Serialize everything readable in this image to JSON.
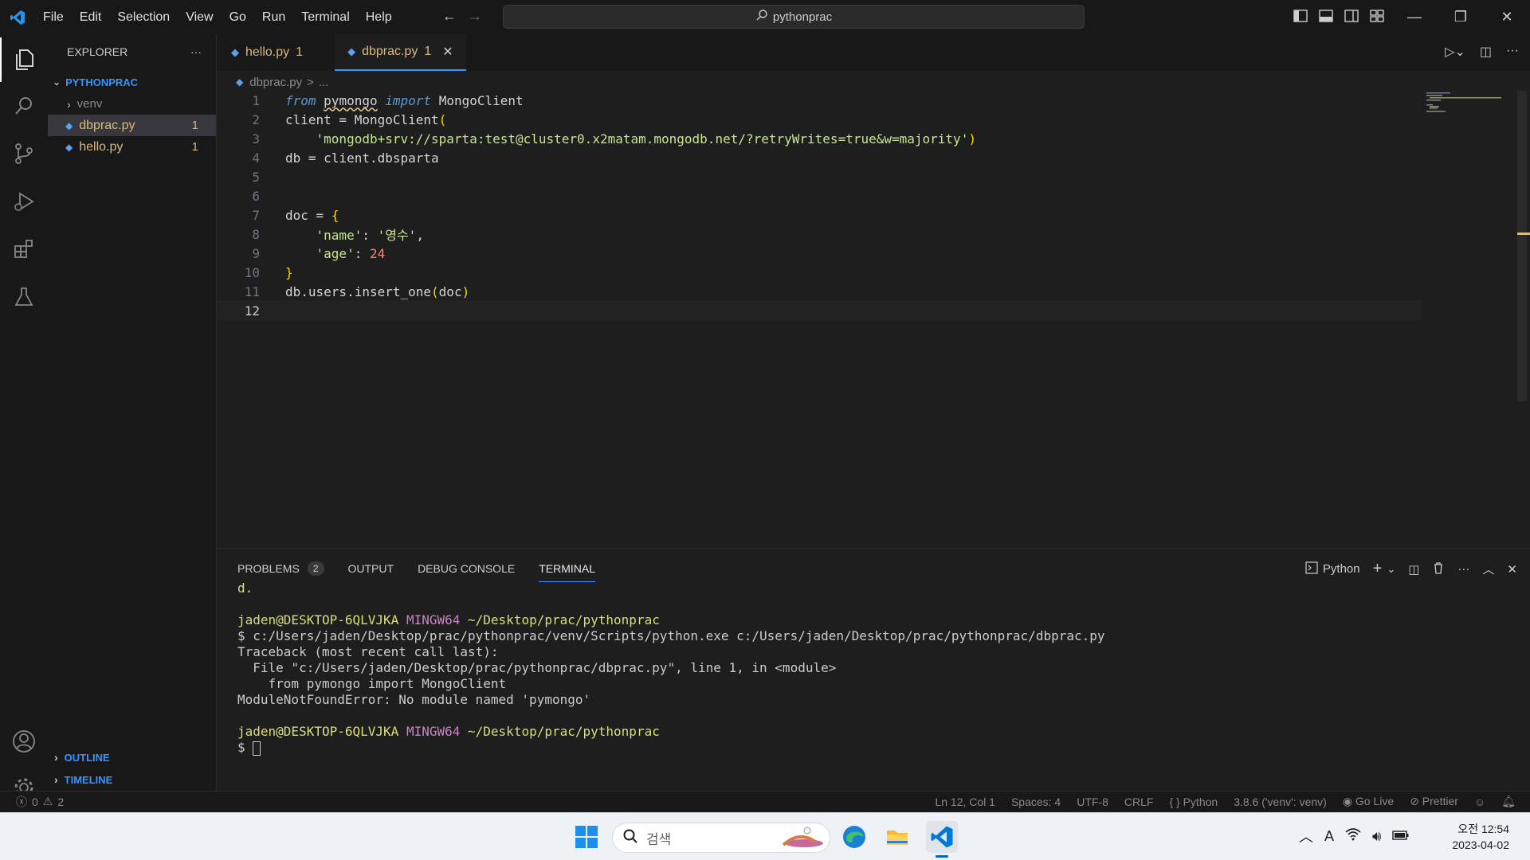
{
  "titlebar": {
    "menu": [
      "File",
      "Edit",
      "Selection",
      "View",
      "Go",
      "Run",
      "Terminal",
      "Help"
    ],
    "search_text": "pythonprac"
  },
  "sidebar": {
    "title": "EXPLORER",
    "more": "···",
    "folder": "PYTHONPRAC",
    "items": [
      {
        "label": "venv",
        "type": "folder"
      },
      {
        "label": "dbprac.py",
        "badge": "1"
      },
      {
        "label": "hello.py",
        "badge": "1"
      }
    ],
    "outline": "OUTLINE",
    "timeline": "TIMELINE"
  },
  "tabs": [
    {
      "label": "hello.py",
      "badge": "1"
    },
    {
      "label": "dbprac.py",
      "badge": "1"
    }
  ],
  "breadcrumb": {
    "file": "dbprac.py",
    "sep": ">",
    "rest": "..."
  },
  "editor": {
    "line_numbers": [
      "1",
      "2",
      "3",
      "4",
      "5",
      "6",
      "7",
      "8",
      "9",
      "10",
      "11",
      "12"
    ],
    "l1": {
      "kw1": "from",
      "mod": "pymongo",
      "kw2": "import",
      "cls": "MongoClient"
    },
    "l2": {
      "var": "client",
      "eq": " = ",
      "fn": "MongoClient",
      "paren": "("
    },
    "l3": {
      "str": "'mongodb+srv://sparta:test@cluster0.x2matam.mongodb.net/?retryWrites=true&w=majority'",
      "paren": ")"
    },
    "l4": {
      "text": "db = client.dbsparta"
    },
    "l7": {
      "var": "doc",
      "eq": " = ",
      "brace": "{"
    },
    "l8": {
      "key": "'name'",
      "colon": ": ",
      "val": "'영수'",
      "comma": ","
    },
    "l9": {
      "key": "'age'",
      "colon": ": ",
      "val": "24"
    },
    "l10": {
      "brace": "}"
    },
    "l11": {
      "pre": "db.users.",
      "fn": "insert_one",
      "open": "(",
      "arg": "doc",
      "close": ")"
    }
  },
  "panel": {
    "tabs": [
      "PROBLEMS",
      "OUTPUT",
      "DEBUG CONSOLE",
      "TERMINAL"
    ],
    "problems_count": "2",
    "shell": "Python",
    "terminal": {
      "line0": "d.",
      "user": "jaden@DESKTOP-6QLVJKA",
      "ming": "MINGW64",
      "cwd": "~/Desktop/prac/pythonprac",
      "cmd": "$ c:/Users/jaden/Desktop/prac/pythonprac/venv/Scripts/python.exe c:/Users/jaden/Desktop/prac/pythonprac/dbprac.py",
      "tb1": "Traceback (most recent call last):",
      "tb2": "  File \"c:/Users/jaden/Desktop/prac/pythonprac/dbprac.py\", line 1, in <module>",
      "tb3": "    from pymongo import MongoClient",
      "tb4": "ModuleNotFoundError: No module named 'pymongo'",
      "prompt": "$ "
    }
  },
  "statusbar": {
    "errors": "0",
    "warnings": "2",
    "position": "Ln 12, Col 1",
    "spaces": "Spaces: 4",
    "encoding": "UTF-8",
    "eol": "CRLF",
    "language": "Python",
    "interpreter": "3.8.6 ('venv': venv)",
    "golive": "Go Live",
    "prettier": "Prettier"
  },
  "taskbar": {
    "search_placeholder": "검색",
    "time": "오전 12:54",
    "date": "2023-04-02",
    "ime": "A"
  },
  "colors": {
    "accent": "#3794ff",
    "warning": "#d7ba7d",
    "vscode_blue": "#0078d4"
  }
}
